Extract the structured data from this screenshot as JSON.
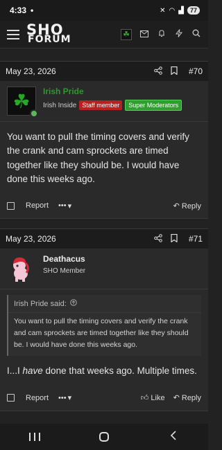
{
  "status": {
    "time": "4:33",
    "dot": "•",
    "battery": "77",
    "signal": "▲",
    "wifi": "◠"
  },
  "nav": {
    "logo_line1": "SHO",
    "logo_line2": "FORUM"
  },
  "posts": [
    {
      "date": "May 23, 2026",
      "number": "#70",
      "user": {
        "name": "Irish Pride",
        "title": "Irish Inside",
        "badges": [
          "Staff member",
          "Super Moderators"
        ]
      },
      "body": "You want to pull the timing covers and verify the crank and cam sprockets are timed together like they should be. I would have done this weeks ago.",
      "actions": {
        "report": "Report",
        "more": "•••",
        "reply": "Reply"
      }
    },
    {
      "date": "May 23, 2026",
      "number": "#71",
      "user": {
        "name": "Deathacus",
        "title": "SHO Member"
      },
      "quote": {
        "author": "Irish Pride said:",
        "text": "You want to pull the timing covers and verify the crank and cam sprockets are timed together like they should be. I would have done this weeks ago."
      },
      "body_pre": "I...I ",
      "body_em": "have",
      "body_post": " done that weeks ago. Multiple times.",
      "actions": {
        "report": "Report",
        "more": "•••",
        "like": "Like",
        "reply": "Reply"
      }
    }
  ],
  "colors": {
    "background": "#222222",
    "post_bg": "#2a2a2a",
    "header_bg": "#1c1c1c",
    "username_green": "#2b9a2b",
    "badge_red": "#b52222",
    "badge_green": "#2e9f2e"
  }
}
